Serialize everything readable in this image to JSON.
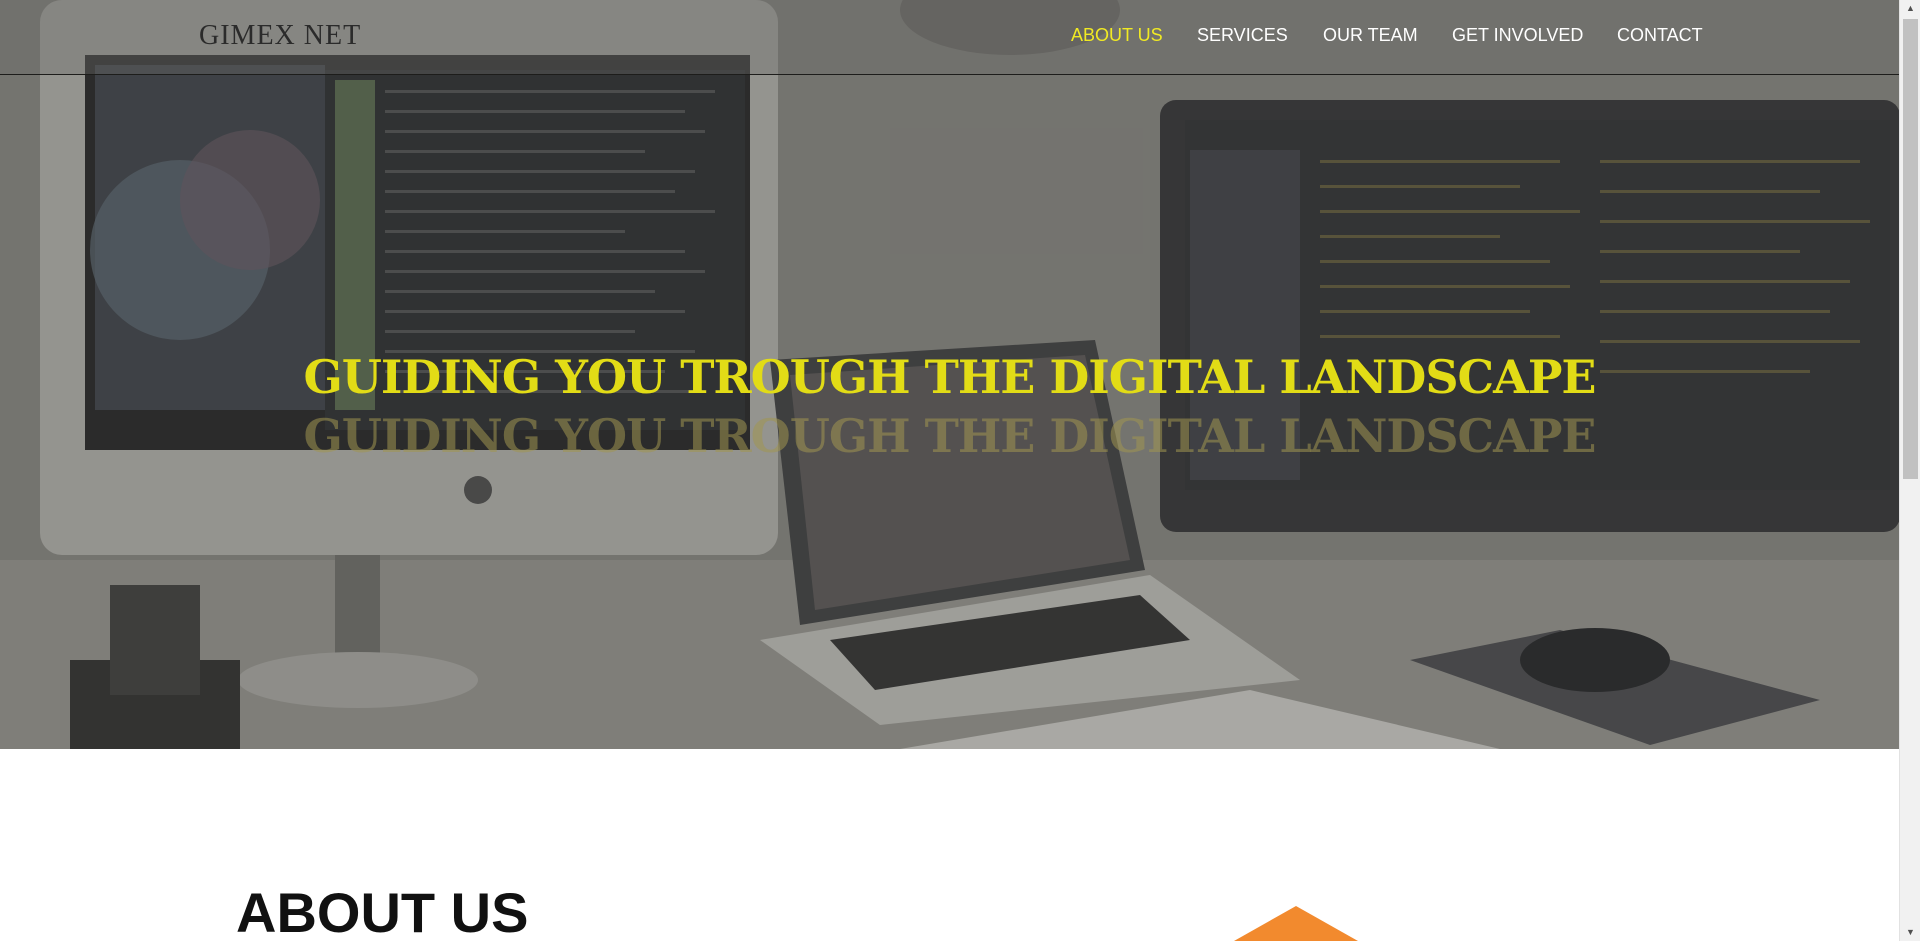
{
  "brand": {
    "name": "GIMEX NET"
  },
  "nav": {
    "items": [
      {
        "label": "ABOUT US",
        "active": true
      },
      {
        "label": "SERVICES",
        "active": false
      },
      {
        "label": "OUR TEAM",
        "active": false
      },
      {
        "label": "GET INVOLVED",
        "active": false
      },
      {
        "label": "CONTACT",
        "active": false
      }
    ]
  },
  "hero": {
    "headline": "GUIDING YOU TROUGH THE DIGITAL LANDSCAPE",
    "headline_reflection": "GUIDING YOU TROUGH THE DIGITAL LANDSCAPE"
  },
  "about": {
    "title": "ABOUT US"
  },
  "colors": {
    "accent_yellow": "#f1ea23",
    "headline_yellow": "#e2dc16",
    "shape_orange": "#f28a2e",
    "nav_text": "#ffffff"
  }
}
